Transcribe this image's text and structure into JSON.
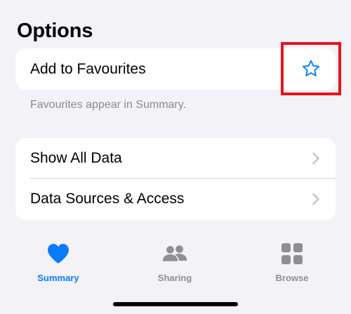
{
  "section": {
    "title": "Options"
  },
  "favourites": {
    "label": "Add to Favourites",
    "footnote": "Favourites appear in Summary.",
    "icon": "star-outline-icon"
  },
  "list": {
    "items": [
      {
        "label": "Show All Data",
        "icon": "chevron-right-icon"
      },
      {
        "label": "Data Sources & Access",
        "icon": "chevron-right-icon"
      }
    ]
  },
  "tabbar": {
    "tabs": [
      {
        "label": "Summary",
        "icon": "heart-icon",
        "selected": true
      },
      {
        "label": "Sharing",
        "icon": "people-icon",
        "selected": false
      },
      {
        "label": "Browse",
        "icon": "grid-icon",
        "selected": false
      }
    ]
  },
  "colors": {
    "accent": "#0A7AFF",
    "inactive": "#8E8E93",
    "highlight_border": "#E8141C",
    "background": "#F2F2F7"
  }
}
